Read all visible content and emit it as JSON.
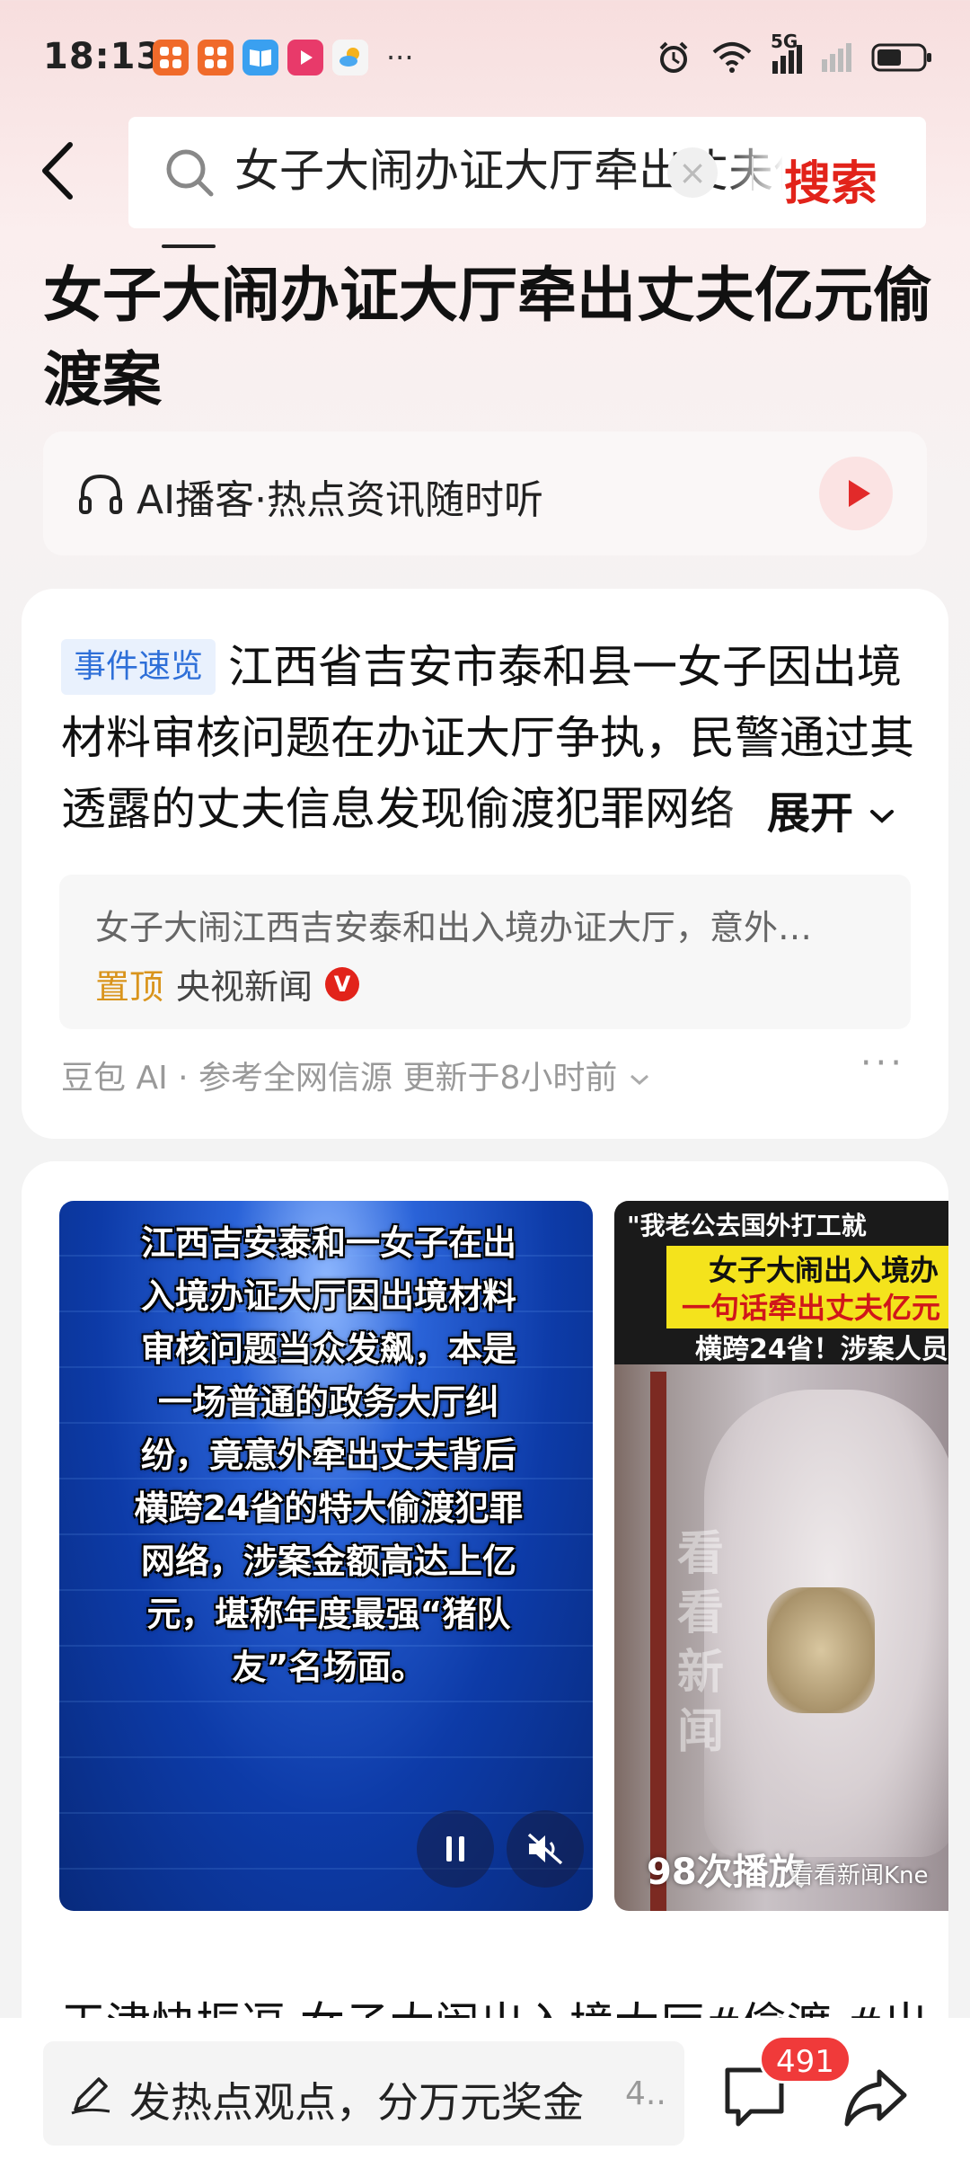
{
  "status_bar": {
    "time": "18:13",
    "network": "5G",
    "app_icons": [
      "app-icon",
      "app-icon",
      "book-icon",
      "video-icon",
      "weather-icon"
    ],
    "more": "···"
  },
  "header": {
    "search_query": "女子大闹办证大厅牵出丈夫亿元偷渡案",
    "search_button": "搜索",
    "clear_icon": "×"
  },
  "page_title": "女子大闹办证大厅牵出丈夫亿元偷渡案",
  "podcast": {
    "label": "AI播客·热点资讯随时听"
  },
  "summary_card": {
    "tag": "事件速览",
    "summary": "江西省吉安市泰和县一女子因出境材料审核问题在办证大厅争执，民警通过其透露的丈夫信息发现偷渡犯罪网络",
    "expand_label": "展开",
    "source_title": "女子大闹江西吉安泰和出入境办证大厅，意外…",
    "source_pin": "置顶",
    "source_name": "央视新闻",
    "source_verified": "V",
    "footer": "豆包 AI · 参考全网信源 更新于8小时前",
    "more": "···"
  },
  "video_card": {
    "video1_caption": "江西吉安泰和一女子在出入境办证大厅因出境材料审核问题当众发飙，本是一场普通的政务大厅纠纷，竟意外牵出丈夫背后横跨24省的特大偷渡犯罪网络，涉案金额高达上亿元，堪称年度最强“猪队友”名场面。",
    "video2_line1": "\"我老公去国外打工就",
    "video2_line2": "女子大闹出入境办",
    "video2_line3": "一句话牵出丈夫亿元",
    "video2_line4": "横跨24省！涉案人员",
    "video2_watermark": "看看新闻",
    "video2_plays": "98次播放",
    "video2_logo": "看看新闻Kne",
    "next_item_text": "天津快振逗 女子大闹出入境大厅#偷渡 #出"
  },
  "bottom_bar": {
    "comment_placeholder": "发热点观点，分万元奖金",
    "comment_suffix": "4..",
    "comment_badge": "491"
  },
  "colors": {
    "accent_red": "#e2231a",
    "tag_blue": "#2e6fd8",
    "pin_orange": "#d9941c"
  }
}
